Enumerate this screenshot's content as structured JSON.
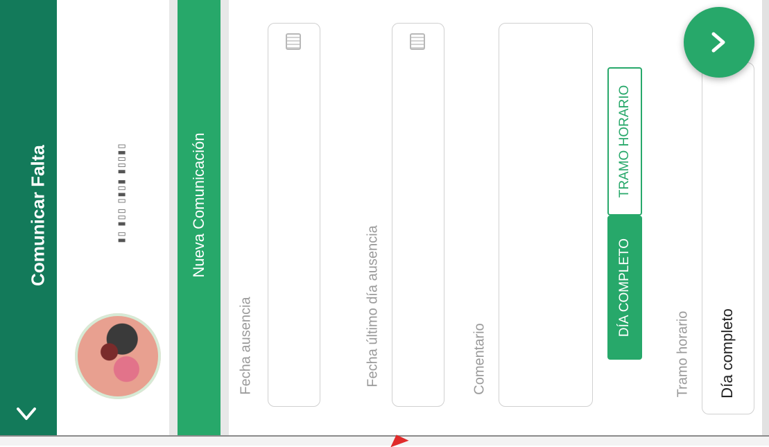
{
  "header": {
    "title": "Comunicar Falta",
    "collapse_icon": "chevron-down-icon"
  },
  "profile": {
    "avatar_icon": "user-avatar"
  },
  "section": {
    "title": "Nueva Comunicación"
  },
  "form": {
    "fecha_ausencia": {
      "label": "Fecha ausencia",
      "value": "",
      "icon": "calendar-icon"
    },
    "fecha_ultimo_dia": {
      "label": "Fecha último día ausencia",
      "value": "",
      "icon": "calendar-icon"
    },
    "comentario": {
      "label": "Comentario",
      "value": ""
    },
    "tipo": {
      "options": [
        "DÍA COMPLETO",
        "TRAMO HORARIO"
      ],
      "selected": "DÍA COMPLETO"
    },
    "tramo_horario": {
      "label": "Tramo horario",
      "value": "Día completo"
    }
  },
  "fab": {
    "icon": "chevron-right-icon"
  },
  "colors": {
    "header_bg": "#137a5a",
    "accent": "#27a86a",
    "label": "#9a9a9a",
    "marker": "#e02b2b"
  }
}
